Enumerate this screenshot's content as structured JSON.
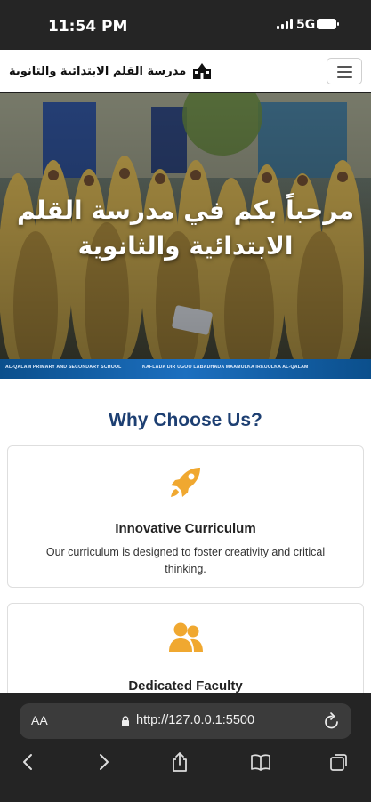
{
  "status": {
    "time": "11:54 PM",
    "network": "5G"
  },
  "navbar": {
    "brand": "مدرسة القلم الابتدائية والثانوية",
    "brand_icon": "school-icon",
    "toggler_icon": "menu-icon"
  },
  "hero": {
    "title": "مرحباً بكم في مدرسة القلم الابتدائية والثانوية",
    "banner_left": "AL-QALAM PRIMARY AND SECONDARY SCHOOL",
    "banner_right": "KAFLADA DIR UGOO LABADHADA MAAMULKA IRKUULKA AL-QALAM"
  },
  "features": {
    "title": "Why Choose Us?",
    "cards": [
      {
        "icon": "rocket-icon",
        "title": "Innovative Curriculum",
        "text": "Our curriculum is designed to foster creativity and critical thinking."
      },
      {
        "icon": "users-icon",
        "title": "Dedicated Faculty"
      }
    ]
  },
  "browser": {
    "text_size": "AA",
    "url": "http://127.0.0.1:5500",
    "toolbar": [
      "back-icon",
      "forward-icon",
      "share-icon",
      "bookmarks-icon",
      "tabs-icon"
    ]
  },
  "colors": {
    "accent": "#f0a830",
    "heading": "#1d3f72",
    "banner": "#1c6fbf"
  }
}
